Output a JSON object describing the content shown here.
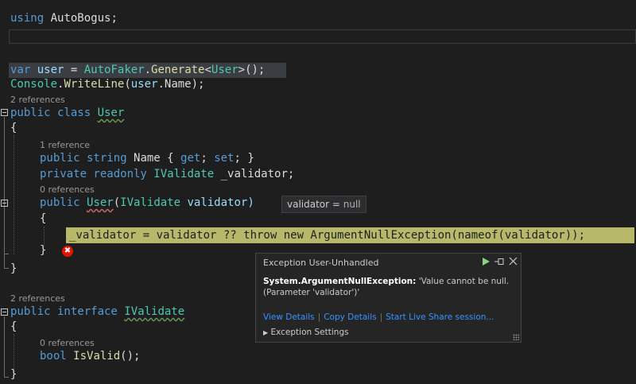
{
  "code": {
    "line_using": {
      "kw": "using",
      "rest": " AutoBogus;"
    },
    "line_var": {
      "kw": "var",
      "v": " user",
      "eq": " = ",
      "cls": "AutoFaker",
      "dot": ".",
      "mt": "Generate",
      "lt": "<",
      "ty": "User",
      "end": ">();"
    },
    "line_console": {
      "ty": "Console",
      "dot": ".",
      "mt": "WriteLine",
      "open": "(",
      "v": "user",
      "rest": ".Name);"
    },
    "refs_class": "2 references",
    "line_class": {
      "kw": "public class ",
      "ty": "User"
    },
    "brace_open": "{",
    "refs_name": "1 reference",
    "line_name": {
      "kw": "public string ",
      "rest": "Name { ",
      "get": "get",
      "semi1": "; ",
      "set": "set",
      "tail": "; }"
    },
    "line_field": {
      "kw": "private readonly ",
      "ty": "IValidate",
      "rest": " _validator;"
    },
    "refs_ctor": "0 references",
    "line_ctor": {
      "kw": "public ",
      "ty": "User",
      "open": "(",
      "pty": "IValidate",
      "rest": " validator)"
    },
    "brace_open2": "{",
    "line_throw": "_validator = validator ?? throw new ArgumentNullException(nameof(validator));",
    "brace_close2": "}",
    "brace_close": "}",
    "refs_iface": "2 references",
    "line_iface": {
      "kw": "public interface ",
      "ty": "IValidate"
    },
    "brace_open3": "{",
    "refs_isvalid": "0 references",
    "line_isvalid": {
      "kw": "bool ",
      "mt": "IsValid",
      "rest": "();"
    },
    "brace_close3": "}"
  },
  "datatip": {
    "name": "validator",
    "eq": " = ",
    "value": "null"
  },
  "error_glyph": "✖",
  "exception_popup": {
    "title": "Exception User-Unhandled",
    "exception_type": "System.ArgumentNullException:",
    "message": " 'Value cannot be null. (Parameter 'validator')'",
    "links": [
      "View Details",
      "Copy Details",
      "Start Live Share session..."
    ],
    "settings_label": "Exception Settings",
    "continue_icon": "play-icon",
    "pin_icon": "pin-icon",
    "close_icon": "close-icon"
  },
  "colors": {
    "background": "#1e1e1e",
    "highlight": "#d4d479",
    "link": "#3794ff",
    "error": "#e51400"
  }
}
